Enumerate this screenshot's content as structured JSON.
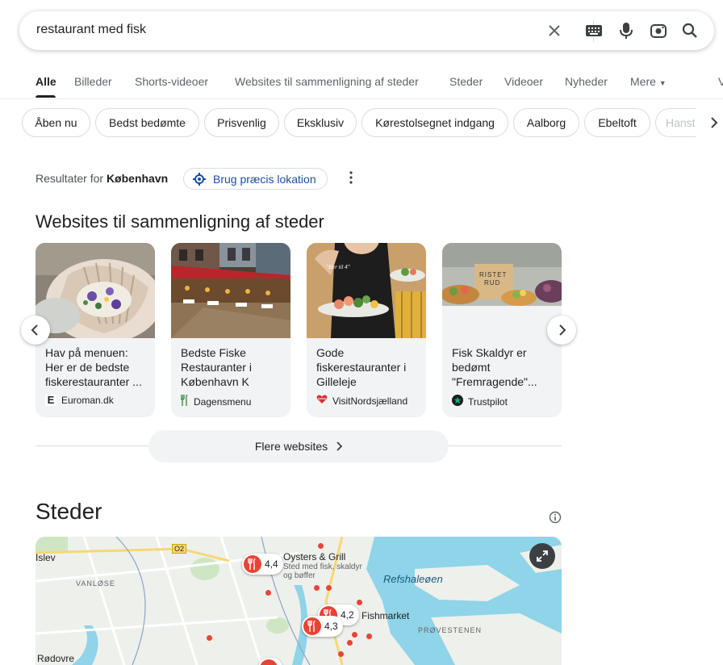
{
  "search": {
    "query": "restaurant med fisk"
  },
  "tabs": [
    {
      "label": "Alle",
      "active": true
    },
    {
      "label": "Billeder"
    },
    {
      "label": "Shorts-videoer"
    },
    {
      "label": "Websites til sammenligning af steder"
    },
    {
      "label": "Steder"
    },
    {
      "label": "Videoer"
    },
    {
      "label": "Nyheder"
    },
    {
      "label": "Mere"
    },
    {
      "label": "V"
    }
  ],
  "chips": [
    "Åben nu",
    "Bedst bedømte",
    "Prisvenlig",
    "Eksklusiv",
    "Kørestolsegnet indgang",
    "Aalborg",
    "Ebeltoft",
    "Hanst"
  ],
  "location": {
    "prefix": "Resultater for",
    "city": "København",
    "precise_button": "Brug præcis lokation"
  },
  "websites": {
    "title": "Websites til sammenligning af steder",
    "cards": [
      {
        "title": "Hav på menuen: Her er de bedste fiskerestauranter ...",
        "source": "Euroman.dk"
      },
      {
        "title": "Bedste Fiske Restauranter i København K",
        "source": "Dagensmenu"
      },
      {
        "title": "Gode fiskerestauranter i Gilleleje",
        "source": "VisitNordsjælland"
      },
      {
        "title": "Fisk Skaldyr er bedømt \"Fremragende\"...",
        "source": "Trustpilot"
      }
    ],
    "more_label": "Flere websites"
  },
  "places": {
    "title": "Steder",
    "map": {
      "labels": {
        "islev": "Islev",
        "vanlose": "VANLØSE",
        "rodovre": "Rødovre",
        "refshaleoen": "Refshaleøen",
        "provestenen": "PRØVESTENEN",
        "route": "O2"
      },
      "pins": [
        {
          "rating": "4,4",
          "name": "Oysters & Grill",
          "desc": "Sted med fisk, skaldyr og bøffer"
        },
        {
          "rating": "4,2",
          "name": "Fishmarket"
        },
        {
          "rating": "4,3"
        }
      ]
    }
  },
  "colors": {
    "accent_blue": "#1a4fa0",
    "pin_red": "#ea4335",
    "water": "#8fd4e8"
  }
}
